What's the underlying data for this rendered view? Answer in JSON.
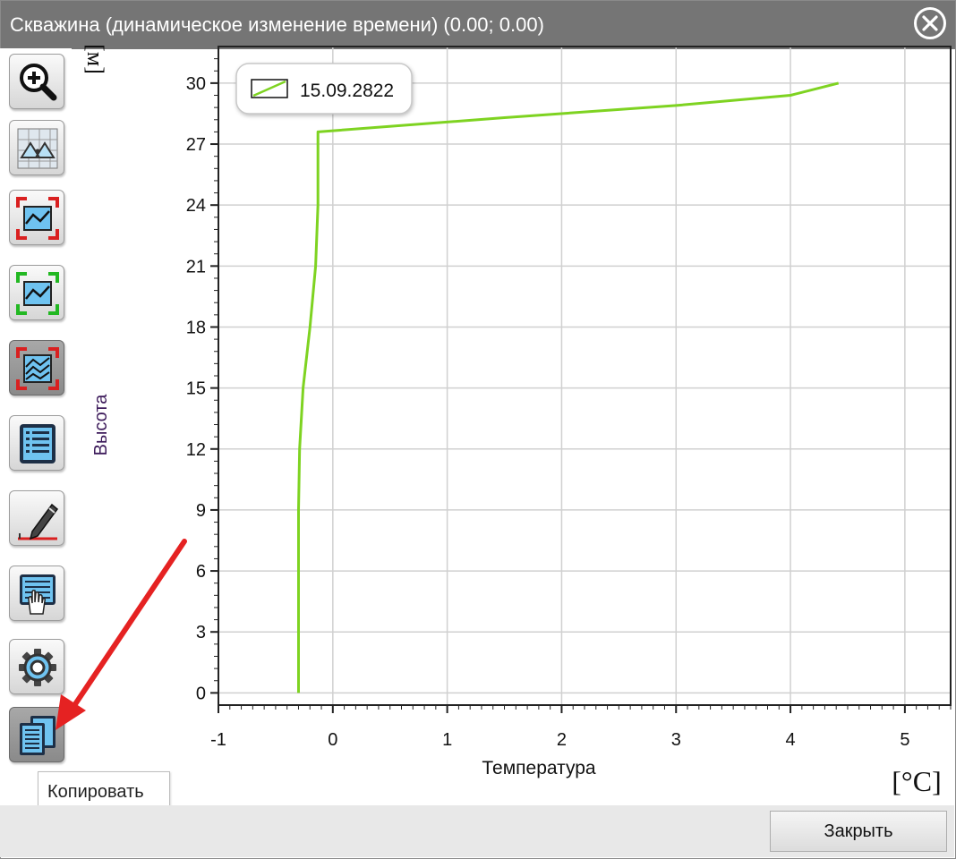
{
  "window": {
    "title": "Скважина (динамическое изменение времени) (0.00; 0.00)"
  },
  "toolbar": {
    "buttons": [
      {
        "name": "zoom-in-button",
        "icon": "magnifier-plus-icon"
      },
      {
        "name": "triangulation-button",
        "icon": "grid-triangles-icon"
      },
      {
        "name": "fit-chart-red-button",
        "icon": "chart-red-frame-icon"
      },
      {
        "name": "fit-chart-green-button",
        "icon": "chart-green-frame-icon"
      },
      {
        "name": "multi-chart-button",
        "icon": "multi-series-chart-icon"
      },
      {
        "name": "list-button",
        "icon": "list-icon"
      },
      {
        "name": "edit-button",
        "icon": "pencil-icon"
      },
      {
        "name": "select-data-button",
        "icon": "hand-document-icon"
      },
      {
        "name": "settings-button",
        "icon": "gear-icon"
      },
      {
        "name": "copy-button",
        "icon": "copy-icon"
      }
    ],
    "tooltip": "Копировать"
  },
  "footer": {
    "close_label": "Закрыть"
  },
  "annotation": {
    "arrow_color": "#e52222"
  },
  "chart_data": {
    "type": "line",
    "xlabel": "Температура",
    "ylabel": "Высота",
    "x_unit": "[°C]",
    "y_unit": "[м]",
    "xlim": [
      -1,
      5.4
    ],
    "ylim": [
      -0.6,
      31.8
    ],
    "x_ticks": [
      -1,
      0,
      1,
      2,
      3,
      4,
      5
    ],
    "y_ticks": [
      0,
      3,
      6,
      9,
      12,
      15,
      18,
      21,
      24,
      27,
      30
    ],
    "grid": true,
    "legend_position": "top-left",
    "series": [
      {
        "name": "15.09.2822",
        "color": "#7ed321",
        "points": [
          {
            "x": -0.3,
            "y": 0
          },
          {
            "x": -0.3,
            "y": 3
          },
          {
            "x": -0.3,
            "y": 6
          },
          {
            "x": -0.3,
            "y": 9
          },
          {
            "x": -0.29,
            "y": 12
          },
          {
            "x": -0.26,
            "y": 15
          },
          {
            "x": -0.2,
            "y": 18
          },
          {
            "x": -0.15,
            "y": 21
          },
          {
            "x": -0.13,
            "y": 24
          },
          {
            "x": -0.13,
            "y": 27
          },
          {
            "x": -0.13,
            "y": 27.6
          },
          {
            "x": 1.5,
            "y": 28.3
          },
          {
            "x": 3.0,
            "y": 28.9
          },
          {
            "x": 4.0,
            "y": 29.4
          },
          {
            "x": 4.42,
            "y": 30
          }
        ]
      }
    ]
  }
}
